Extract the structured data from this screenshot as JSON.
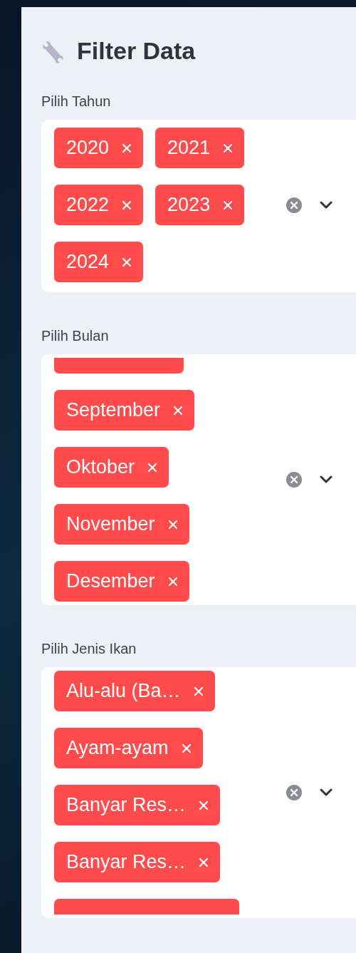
{
  "title": "Filter Data",
  "filters": [
    {
      "label": "Pilih Tahun",
      "tags": [
        {
          "kind": "tag",
          "label": "2020"
        },
        {
          "kind": "tag",
          "label": "2021"
        },
        {
          "kind": "tag",
          "label": "2022"
        },
        {
          "kind": "tag",
          "label": "2023"
        },
        {
          "kind": "tag",
          "label": "2024"
        }
      ]
    },
    {
      "label": "Pilih Bulan",
      "tags": [
        {
          "kind": "partial"
        },
        {
          "kind": "tag",
          "label": "September"
        },
        {
          "kind": "tag",
          "label": "Oktober"
        },
        {
          "kind": "tag",
          "label": "November"
        },
        {
          "kind": "tag",
          "label": "Desember"
        }
      ]
    },
    {
      "label": "Pilih Jenis Ikan",
      "tags": [
        {
          "kind": "tag",
          "label": "Alu-alu (Ba…"
        },
        {
          "kind": "tag",
          "label": "Ayam-ayam"
        },
        {
          "kind": "tag",
          "label": "Banyar Res…"
        },
        {
          "kind": "tag",
          "label": "Banyar Res…"
        },
        {
          "kind": "partial"
        }
      ]
    }
  ]
}
